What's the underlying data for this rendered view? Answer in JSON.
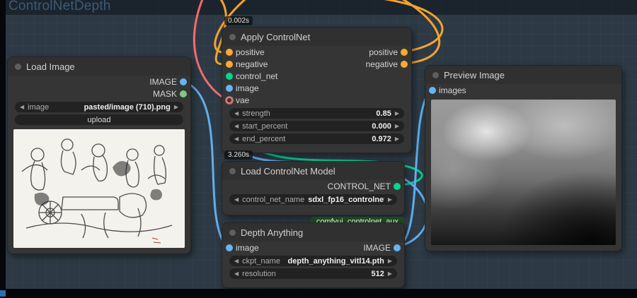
{
  "workflow": {
    "title": "ControlNetDepth"
  },
  "colors": {
    "conditioning": "#ffa931",
    "image_type": "#64b5f6",
    "mask_type": "#81c784",
    "control_net_type": "#00d78d",
    "vae_type": "#ff6e6e"
  },
  "nodes": {
    "load_image": {
      "title": "Load Image",
      "outputs": [
        {
          "label": "IMAGE"
        },
        {
          "label": "MASK"
        }
      ],
      "widgets": [
        {
          "label": "image",
          "value": "pasted/image (710).png"
        }
      ],
      "button_label": "upload"
    },
    "apply_controlnet": {
      "timer": "0.002s",
      "title": "Apply ControlNet",
      "inputs": [
        {
          "label": "positive"
        },
        {
          "label": "negative"
        },
        {
          "label": "control_net"
        },
        {
          "label": "image"
        },
        {
          "label": "vae"
        }
      ],
      "outputs": [
        {
          "label": "positive"
        },
        {
          "label": "negative"
        }
      ],
      "widgets": [
        {
          "label": "strength",
          "value": "0.85"
        },
        {
          "label": "start_percent",
          "value": "0.000"
        },
        {
          "label": "end_percent",
          "value": "0.972"
        }
      ]
    },
    "load_controlnet_model": {
      "timer": "3.260s",
      "title": "Load ControlNet Model",
      "outputs": [
        {
          "label": "CONTROL_NET"
        }
      ],
      "widgets": [
        {
          "label": "control_net_name",
          "value": "sdxl_fp16_controlnet..."
        }
      ],
      "badge": "comfyui_controlnet_aux"
    },
    "depth_anything": {
      "title": "Depth Anything",
      "inputs": [
        {
          "label": "image"
        }
      ],
      "outputs": [
        {
          "label": "IMAGE"
        }
      ],
      "widgets": [
        {
          "label": "ckpt_name",
          "value": "depth_anything_vitl14.pth"
        },
        {
          "label": "resolution",
          "value": "512"
        }
      ]
    },
    "preview_image": {
      "title": "Preview Image",
      "inputs": [
        {
          "label": "images"
        }
      ]
    }
  },
  "connections": [
    {
      "from": "offscreen-top",
      "to": "Apply ControlNet.positive",
      "type": "CONDITIONING"
    },
    {
      "from": "offscreen-top",
      "to": "Apply ControlNet.negative",
      "type": "CONDITIONING"
    },
    {
      "from": "offscreen-top",
      "to": "Apply ControlNet.vae",
      "type": "VAE"
    },
    {
      "from": "Apply ControlNet.positive",
      "to": "offscreen-top",
      "type": "CONDITIONING"
    },
    {
      "from": "Apply ControlNet.negative",
      "to": "offscreen-top",
      "type": "CONDITIONING"
    },
    {
      "from": "Load ControlNet Model.CONTROL_NET",
      "to": "Apply ControlNet.control_net",
      "type": "CONTROL_NET"
    },
    {
      "from": "Load Image.IMAGE",
      "to": "Depth Anything.image",
      "type": "IMAGE"
    },
    {
      "from": "Depth Anything.IMAGE",
      "to": "Apply ControlNet.image",
      "type": "IMAGE"
    },
    {
      "from": "Depth Anything.IMAGE",
      "to": "Preview Image.images",
      "type": "IMAGE"
    }
  ]
}
